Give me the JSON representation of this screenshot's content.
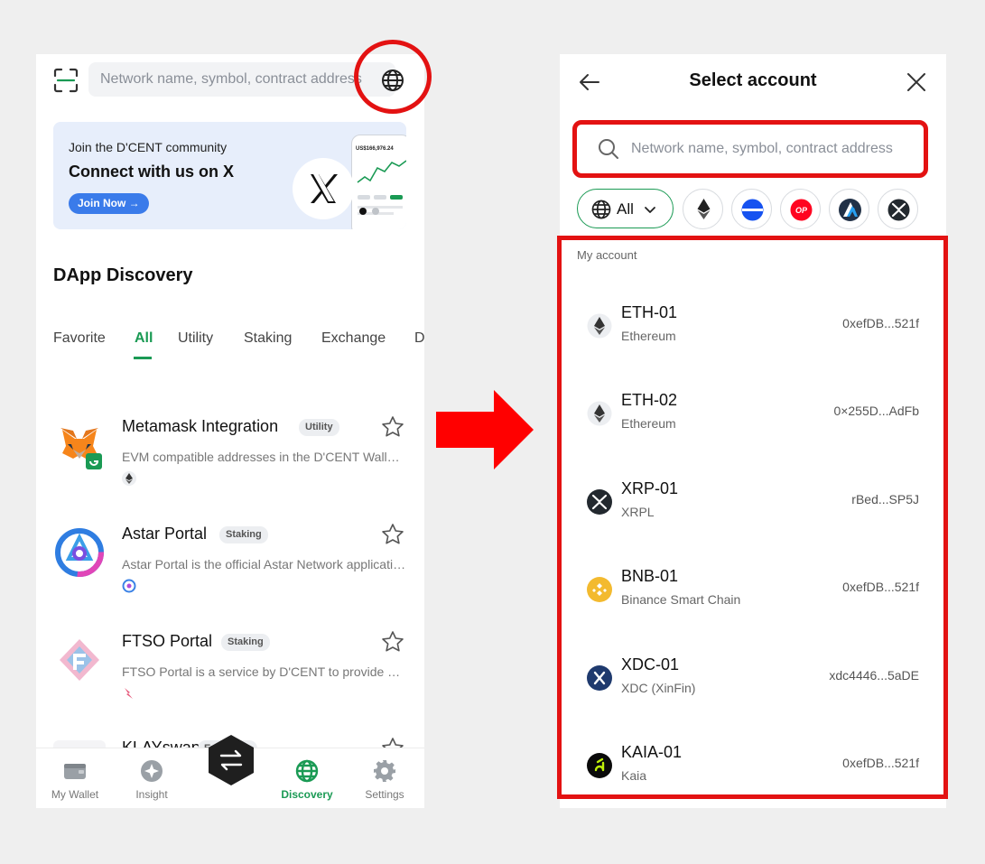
{
  "left_screen": {
    "search": {
      "placeholder": "Network name, symbol, contract address"
    },
    "banner": {
      "subtitle": "Join the D'CENT community",
      "title": "Connect with us on X",
      "cta": "Join Now →",
      "phone_amount": "US$166,976.24"
    },
    "section_title": "DApp Discovery",
    "tabs": [
      "Favorite",
      "All",
      "Utility",
      "Staking",
      "Exchange",
      "D"
    ],
    "active_tab": "All",
    "dapps": [
      {
        "name": "Metamask Integration",
        "badge": "Utility",
        "description": "EVM compatible addresses in the D'CENT Wallet can be used in Metamask"
      },
      {
        "name": "Astar Portal",
        "badge": "Staking",
        "description": "Astar Portal is the official Astar Network application"
      },
      {
        "name": "FTSO Portal",
        "badge": "Staking",
        "description": "FTSO Portal is a service by D'CENT to provide delegation"
      },
      {
        "name": "KLAYswap",
        "badge": "Exchange",
        "description": ""
      }
    ],
    "bottom_nav": [
      "My Wallet",
      "Insight",
      "Discovery",
      "Settings"
    ],
    "active_nav": "Discovery"
  },
  "right_screen": {
    "title": "Select account",
    "search": {
      "placeholder": "Network name, symbol, contract address"
    },
    "filter_all_label": "All",
    "filter_chips": [
      "ethereum-icon",
      "base-icon",
      "optimism-icon",
      "arbitrum-icon",
      "xrp-icon"
    ],
    "list_label": "My account",
    "accounts": [
      {
        "name": "ETH-01",
        "network": "Ethereum",
        "address": "0xefDB...521f",
        "icon": "ethereum-icon"
      },
      {
        "name": "ETH-02",
        "network": "Ethereum",
        "address": "0×255D...AdFb",
        "icon": "ethereum-icon"
      },
      {
        "name": "XRP-01",
        "network": "XRPL",
        "address": "rBed...SP5J",
        "icon": "xrp-icon"
      },
      {
        "name": "BNB-01",
        "network": "Binance Smart Chain",
        "address": "0xefDB...521f",
        "icon": "bnb-icon"
      },
      {
        "name": "XDC-01",
        "network": "XDC (XinFin)",
        "address": "xdc4446...5aDE",
        "icon": "xdc-icon"
      },
      {
        "name": "KAIA-01",
        "network": "Kaia",
        "address": "0xefDB...521f",
        "icon": "kaia-icon"
      }
    ]
  },
  "colors": {
    "accent_green": "#1a9a54",
    "highlight_red": "#e31212",
    "banner_bg": "#e7eefb",
    "join_button": "#3a7bea"
  }
}
